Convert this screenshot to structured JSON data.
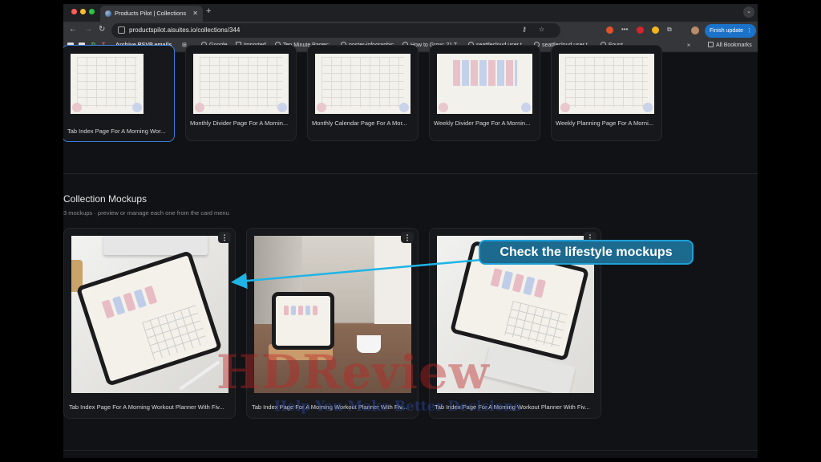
{
  "browser": {
    "tab_title": "Products Pilot | Collections",
    "url": "productspilot.aisuites.io/collections/344",
    "finish_update_label": "Finish update",
    "bookmarks": [
      "D",
      "T",
      "Archive RSVP emails",
      "Google",
      "Imported",
      "Ten Minute Pages:...",
      "poster-infographic",
      "How to Grow: 21 T...",
      "seattlecloud user t...",
      "seattlecloud user t...",
      "Fount"
    ],
    "all_bookmarks_label": "All Bookmarks"
  },
  "pages_row": {
    "cards": [
      {
        "caption": "Tab Index Page For A Morning Wor...",
        "selected": true
      },
      {
        "caption": "Monthly Divider Page For A Mornin...",
        "selected": false
      },
      {
        "caption": "Monthly Calendar Page For A Mor...",
        "selected": false
      },
      {
        "caption": "Weekly Divider Page For A Mornin...",
        "selected": false
      },
      {
        "caption": "Weekly Planning Page For A Morni...",
        "selected": false
      }
    ]
  },
  "mockups": {
    "title": "Collection Mockups",
    "subtitle": "3 mockups · preview or manage each one from the card menu",
    "cards": [
      {
        "caption": "Tab Index Page For A Morning Workout Planner With Fiv..."
      },
      {
        "caption": "Tab Index Page For A Morning Workout Planner With Fiv..."
      },
      {
        "caption": "Tab Index Page For A Morning Workout Planner With Fiv..."
      }
    ]
  },
  "annotation": {
    "text": "Check the lifestyle mockups"
  },
  "watermark": {
    "line1": "HDReview",
    "line2": "Help You Make Better Decisions"
  },
  "colors": {
    "accent": "#1a73c8",
    "selection": "#3d7dd8",
    "callout": "#1d6a8f",
    "arrow": "#1fb4e6"
  }
}
